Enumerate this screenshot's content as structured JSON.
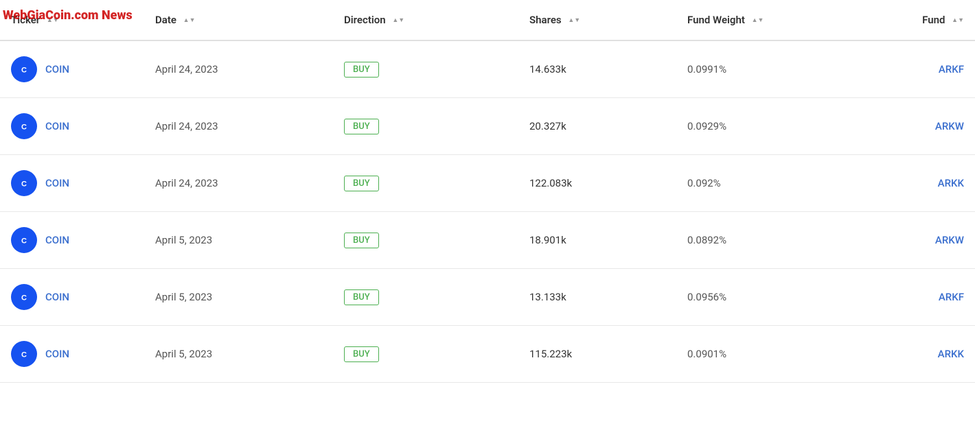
{
  "header": {
    "columns": [
      {
        "id": "ticker",
        "label": "Ticker",
        "sortable": true
      },
      {
        "id": "date",
        "label": "Date",
        "sortable": true
      },
      {
        "id": "direction",
        "label": "Direction",
        "sortable": true
      },
      {
        "id": "shares",
        "label": "Shares",
        "sortable": true
      },
      {
        "id": "fund_weight",
        "label": "Fund Weight",
        "sortable": true
      },
      {
        "id": "fund",
        "label": "Fund",
        "sortable": true
      }
    ]
  },
  "watermark": "WebGiaCoin.com News",
  "rows": [
    {
      "ticker": "COIN",
      "date": "April 24, 2023",
      "direction": "BUY",
      "shares": "14.633k",
      "fund_weight": "0.0991%",
      "fund": "ARKF"
    },
    {
      "ticker": "COIN",
      "date": "April 24, 2023",
      "direction": "BUY",
      "shares": "20.327k",
      "fund_weight": "0.0929%",
      "fund": "ARKW"
    },
    {
      "ticker": "COIN",
      "date": "April 24, 2023",
      "direction": "BUY",
      "shares": "122.083k",
      "fund_weight": "0.092%",
      "fund": "ARKK"
    },
    {
      "ticker": "COIN",
      "date": "April 5, 2023",
      "direction": "BUY",
      "shares": "18.901k",
      "fund_weight": "0.0892%",
      "fund": "ARKW"
    },
    {
      "ticker": "COIN",
      "date": "April 5, 2023",
      "direction": "BUY",
      "shares": "13.133k",
      "fund_weight": "0.0956%",
      "fund": "ARKF"
    },
    {
      "ticker": "COIN",
      "date": "April 5, 2023",
      "direction": "BUY",
      "shares": "115.223k",
      "fund_weight": "0.0901%",
      "fund": "ARKK"
    }
  ]
}
